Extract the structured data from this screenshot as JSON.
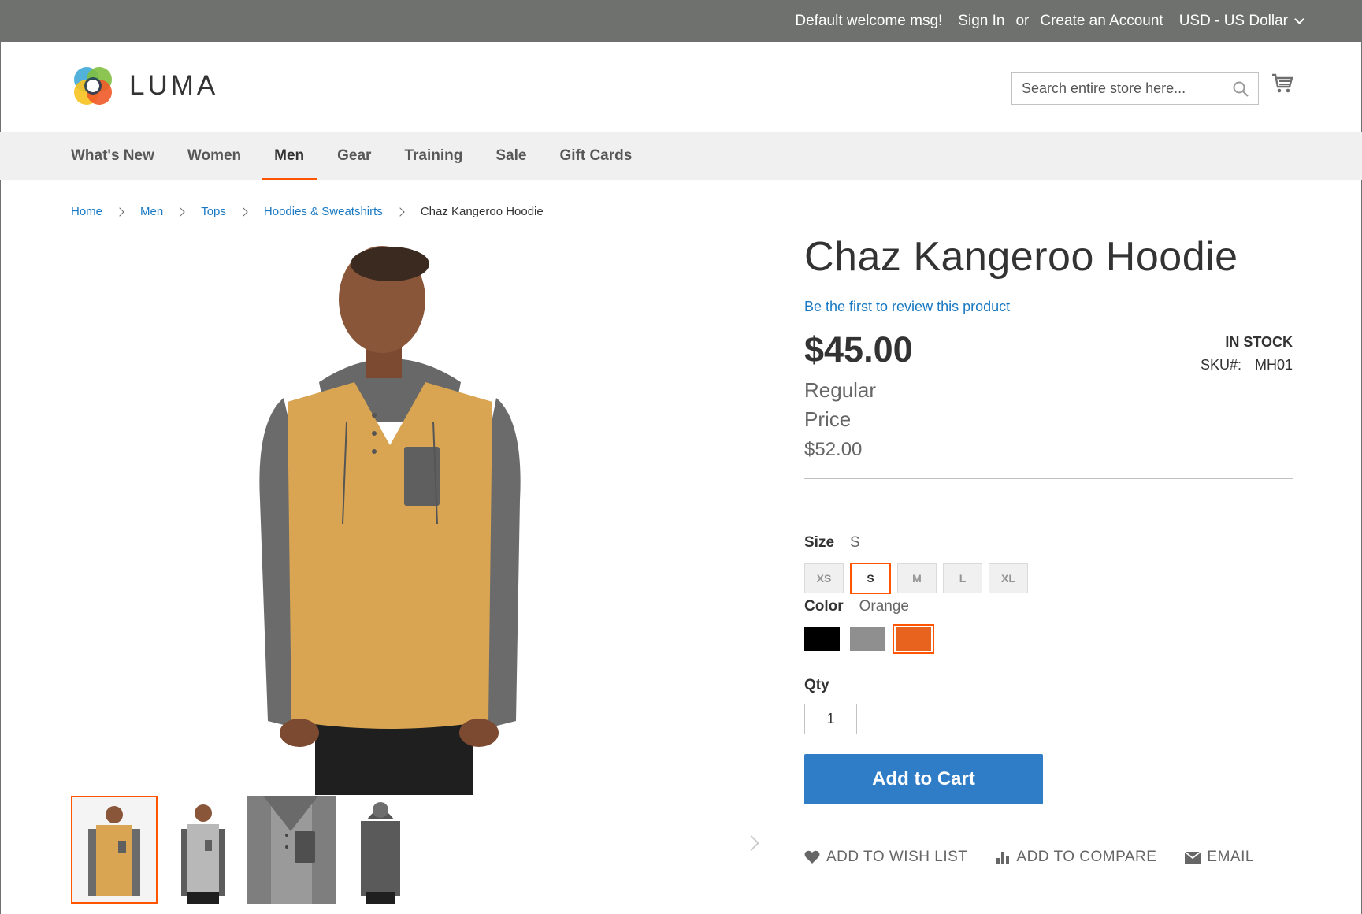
{
  "topbar": {
    "welcome": "Default welcome msg!",
    "sign_in": "Sign In",
    "or": "or",
    "create_account": "Create an Account",
    "currency": "USD - US Dollar"
  },
  "header": {
    "logo_text": "LUMA",
    "search_placeholder": "Search entire store here..."
  },
  "nav": {
    "items": [
      "What's New",
      "Women",
      "Men",
      "Gear",
      "Training",
      "Sale",
      "Gift Cards"
    ],
    "active": "Men"
  },
  "breadcrumbs": [
    "Home",
    "Men",
    "Tops",
    "Hoodies & Sweatshirts",
    "Chaz Kangeroo Hoodie"
  ],
  "product": {
    "title": "Chaz Kangeroo Hoodie",
    "review_link": "Be the first to review this product",
    "price": "$45.00",
    "regular_label_1": "Regular",
    "regular_label_2": "Price",
    "old_price": "$52.00",
    "stock": "IN STOCK",
    "sku_label": "SKU#:",
    "sku": "MH01",
    "size_label": "Size",
    "size_value": "S",
    "sizes": [
      "XS",
      "S",
      "M",
      "L",
      "XL"
    ],
    "color_label": "Color",
    "color_value": "Orange",
    "colors": [
      "#000000",
      "#8f8f8f",
      "#e8631e"
    ],
    "qty_label": "Qty",
    "qty": "1",
    "add_to_cart": "Add to Cart",
    "wishlist": "ADD TO WISH LIST",
    "compare": "ADD TO COMPARE",
    "email": "EMAIL"
  },
  "colors": {
    "accent": "#ff5501",
    "primary_button": "#2f7dc7",
    "link": "#1979c3",
    "topbar_bg": "#6e716e"
  }
}
